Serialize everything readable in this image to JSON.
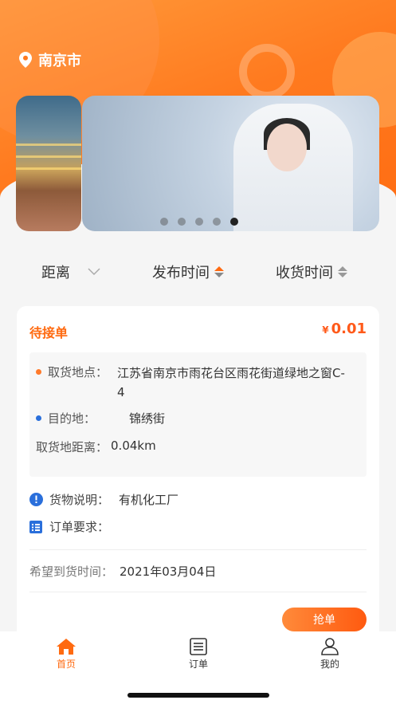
{
  "location": {
    "city": "南京市",
    "icon": "location-pin-icon"
  },
  "banner": {
    "dot_count": 5,
    "active_dot": 4
  },
  "filters": [
    {
      "label": "距离",
      "icon": "chevron-down-icon"
    },
    {
      "label": "发布时间",
      "icon": "sort-icon"
    },
    {
      "label": "收货时间",
      "icon": "sort-icon"
    }
  ],
  "order": {
    "status": "待接单",
    "currency": "¥",
    "price": "0.01",
    "pickup_label": "取货地点：",
    "pickup_value": "江苏省南京市雨花台区雨花街道绿地之窗C-4",
    "dest_label": "目的地：",
    "dest_value": "锦绣街",
    "distance_label": "取货地距离：",
    "distance_value": "0.04km",
    "goods_label": "货物说明：",
    "goods_value": "有机化工厂",
    "req_label": "订单要求：",
    "req_value": "",
    "expected_label": "希望到货时间：",
    "expected_value": "2021年03月04日",
    "grab_button": "抢单"
  },
  "colors": {
    "accent": "#ff6a10",
    "pickup_dot": "#ff7a2a",
    "dest_dot": "#2a6fdb"
  },
  "tabbar": [
    {
      "label": "首页",
      "icon": "home-icon",
      "active": true
    },
    {
      "label": "订单",
      "icon": "order-list-icon",
      "active": false
    },
    {
      "label": "我的",
      "icon": "profile-icon",
      "active": false
    }
  ]
}
